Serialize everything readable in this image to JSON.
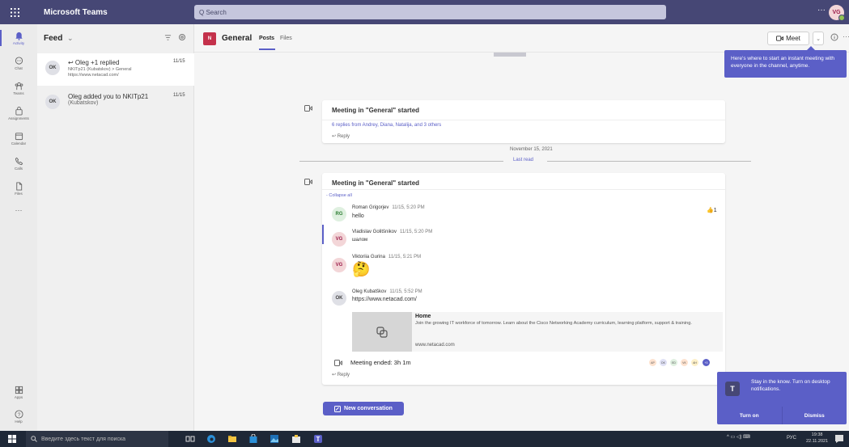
{
  "app": {
    "title": "Microsoft Teams",
    "search_placeholder": "Q Search",
    "more": "···",
    "user_initials": "VG"
  },
  "rail": [
    {
      "label": "Activity",
      "icon": "bell-icon"
    },
    {
      "label": "Chat",
      "icon": "chat-icon"
    },
    {
      "label": "Teams",
      "icon": "teams-icon"
    },
    {
      "label": "Assignments",
      "icon": "assignments-icon"
    },
    {
      "label": "Calendar",
      "icon": "calendar-icon"
    },
    {
      "label": "Calls",
      "icon": "phone-icon"
    },
    {
      "label": "Files",
      "icon": "file-icon"
    },
    {
      "label": "···",
      "icon": "more-icon"
    },
    {
      "label": "Apps",
      "icon": "apps-icon"
    },
    {
      "label": "Help",
      "icon": "help-icon"
    }
  ],
  "feed": {
    "title": "Feed",
    "items": [
      {
        "initials": "OK",
        "line1": "↩ Oleg +1 replied",
        "line2": "NKITp21 (Kubatskov) > General",
        "line3": "https://www.netacad.com/",
        "date": "11/15"
      },
      {
        "initials": "OK",
        "line1": "Oleg added you to NKITp21",
        "line2": "(Kubatskov)",
        "line3": "",
        "date": "11/15"
      }
    ]
  },
  "channel": {
    "team_initials": "N",
    "name": "General",
    "tabs": [
      "Posts",
      "Files"
    ],
    "meet_label": "Meet",
    "tooltip": "Here's where to start an instant meeting with everyone in the channel, anytime."
  },
  "thread1": {
    "title": "Meeting in \"General\" started",
    "replies_summary": "6 replies from Andrey, Diana, Natalija, and 3 others",
    "reply": "↩ Reply"
  },
  "separator": {
    "date": "November 15, 2021",
    "last_read": "Last read"
  },
  "thread2": {
    "title": "Meeting in \"General\" started",
    "collapse": "- Collapse all",
    "messages": [
      {
        "initials": "RG",
        "name": "Roman Grigorjev",
        "time": "11/15, 5:20 PM",
        "text": "hello",
        "reaction": "👍1"
      },
      {
        "initials": "VG",
        "name": "Vladislav Golitšnikov",
        "time": "11/15, 5:20 PM",
        "text": "шалом"
      },
      {
        "initials": "VG",
        "name": "Viktoriia Gurina",
        "time": "11/15, 5:21 PM",
        "text": "🤔"
      },
      {
        "initials": "OK",
        "name": "Oleg Kubatškov",
        "time": "11/15, 5:52 PM",
        "text": "https://www.netacad.com/"
      }
    ],
    "card": {
      "title": "Home",
      "desc": "Join the growing IT workforce of tomorrow. Learn about the Cisco Networking Academy curriculum, learning platform, support & training.",
      "url": "www.netacad.com"
    },
    "meeting_ended": "Meeting ended: 3h 1m",
    "participants": [
      "AP",
      "DK",
      "ED",
      "VK",
      "AH",
      "+3"
    ],
    "reply": "↩ Reply"
  },
  "new_conversation": "New conversation",
  "toast": {
    "text": "Stay in the know. Turn on desktop notifications.",
    "turn_on": "Turn on",
    "dismiss": "Dismiss"
  },
  "taskbar": {
    "search": "Введите здесь текст для поиска",
    "lang": "РУС",
    "time": "19:38",
    "date": "22.11.2021"
  },
  "colors": {
    "brand": "#464775",
    "accent": "#5b5fc7"
  }
}
